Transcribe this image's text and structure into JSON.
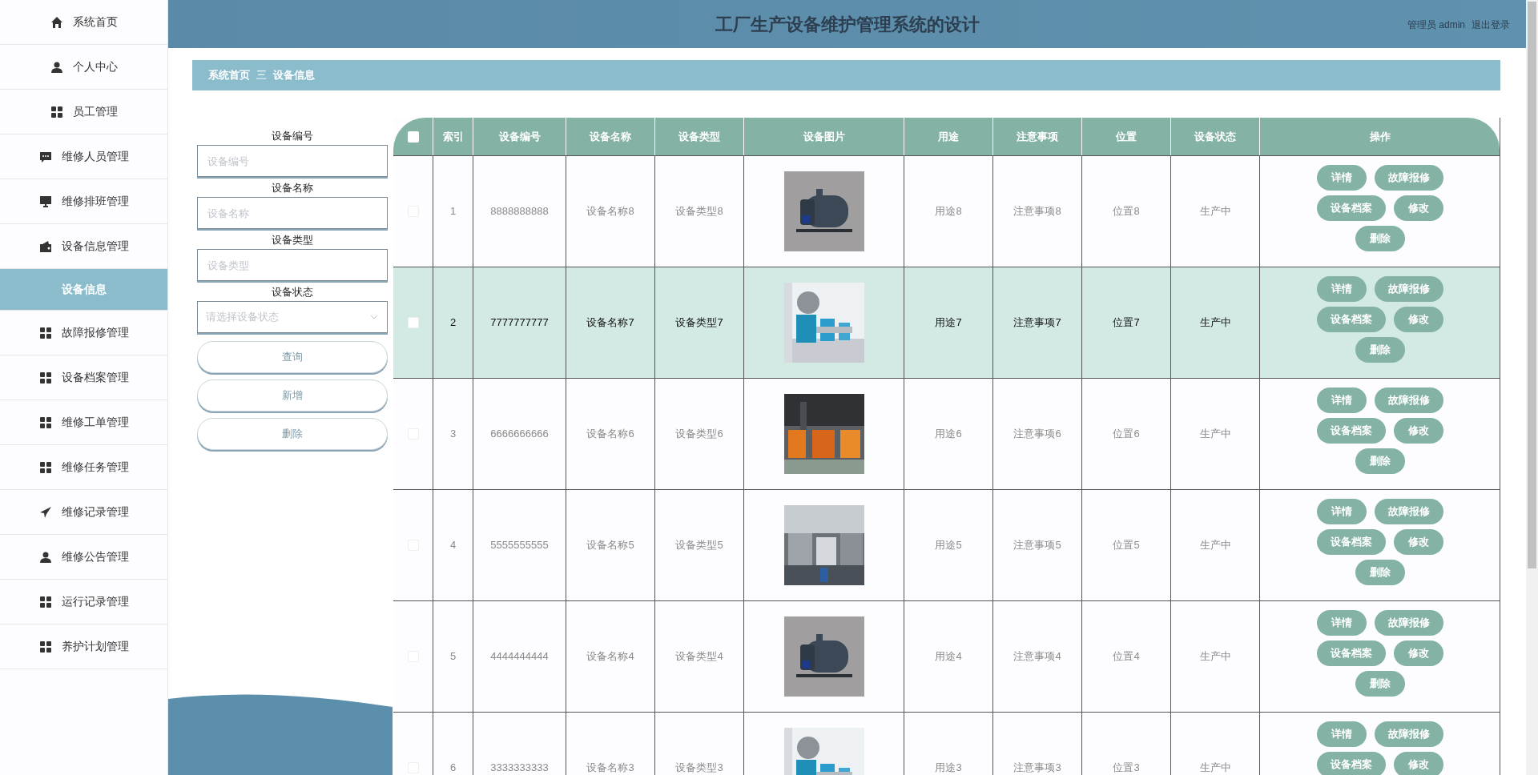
{
  "sidebar": {
    "items": [
      {
        "label": "系统首页",
        "selected": false
      },
      {
        "label": "个人中心",
        "selected": false
      },
      {
        "label": "员工管理",
        "selected": false
      },
      {
        "label": "维修人员管理",
        "selected": false
      },
      {
        "label": "维修排班管理",
        "selected": false
      },
      {
        "label": "设备信息管理",
        "selected": false
      },
      {
        "label": "设备信息",
        "selected": true
      },
      {
        "label": "故障报修管理",
        "selected": false
      },
      {
        "label": "设备档案管理",
        "selected": false
      },
      {
        "label": "维修工单管理",
        "selected": false
      },
      {
        "label": "维修任务管理",
        "selected": false
      },
      {
        "label": "维修记录管理",
        "selected": false
      },
      {
        "label": "维修公告管理",
        "selected": false
      },
      {
        "label": "运行记录管理",
        "selected": false
      },
      {
        "label": "养护计划管理",
        "selected": false
      }
    ]
  },
  "header": {
    "title": "工厂生产设备维护管理系统的设计",
    "user": "管理员 admin",
    "logout": "退出登录"
  },
  "breadcrumb": {
    "items": [
      "系统首页",
      "设备信息"
    ],
    "separator": "三"
  },
  "filters": {
    "fields": [
      {
        "label": "设备编号",
        "placeholder": "设备编号",
        "kind": "text"
      },
      {
        "label": "设备名称",
        "placeholder": "设备名称",
        "kind": "text"
      },
      {
        "label": "设备类型",
        "placeholder": "设备类型",
        "kind": "text"
      },
      {
        "label": "设备状态",
        "placeholder": "请选择设备状态",
        "kind": "select"
      }
    ],
    "buttons": [
      "查询",
      "新增",
      "删除"
    ]
  },
  "table": {
    "columns": [
      "索引",
      "设备编号",
      "设备名称",
      "设备类型",
      "设备图片",
      "用途",
      "注意事项",
      "位置",
      "设备状态",
      "操作"
    ],
    "header_checked": false,
    "rows": [
      {
        "index": "1",
        "code": "8888888888",
        "name": "设备名称8",
        "type": "设备类型8",
        "use": "用途8",
        "notes": "注意事项8",
        "location": "位置8",
        "status": "生产中",
        "highlighted": false,
        "checked": false,
        "actions": [
          "详情",
          "故障报修",
          "设备档案",
          "修改",
          "删除"
        ]
      },
      {
        "index": "2",
        "code": "7777777777",
        "name": "设备名称7",
        "type": "设备类型7",
        "use": "用途7",
        "notes": "注意事项7",
        "location": "位置7",
        "status": "生产中",
        "highlighted": true,
        "checked": false,
        "actions": [
          "详情",
          "故障报修",
          "设备档案",
          "修改",
          "删除"
        ]
      },
      {
        "index": "3",
        "code": "6666666666",
        "name": "设备名称6",
        "type": "设备类型6",
        "use": "用途6",
        "notes": "注意事项6",
        "location": "位置6",
        "status": "生产中",
        "highlighted": false,
        "checked": false,
        "actions": [
          "详情",
          "故障报修",
          "设备档案",
          "修改",
          "删除"
        ]
      },
      {
        "index": "4",
        "code": "5555555555",
        "name": "设备名称5",
        "type": "设备类型5",
        "use": "用途5",
        "notes": "注意事项5",
        "location": "位置5",
        "status": "生产中",
        "highlighted": false,
        "checked": false,
        "actions": [
          "详情",
          "故障报修",
          "设备档案",
          "修改",
          "删除"
        ]
      },
      {
        "index": "5",
        "code": "4444444444",
        "name": "设备名称4",
        "type": "设备类型4",
        "use": "用途4",
        "notes": "注意事项4",
        "location": "位置4",
        "status": "生产中",
        "highlighted": false,
        "checked": false,
        "actions": [
          "详情",
          "故障报修",
          "设备档案",
          "修改",
          "删除"
        ]
      },
      {
        "index": "6",
        "code": "3333333333",
        "name": "设备名称3",
        "type": "设备类型3",
        "use": "用途3",
        "notes": "注意事项3",
        "location": "位置3",
        "status": "生产中",
        "highlighted": false,
        "checked": false,
        "actions": [
          "详情",
          "故障报修",
          "设备档案",
          "修改"
        ]
      }
    ]
  }
}
